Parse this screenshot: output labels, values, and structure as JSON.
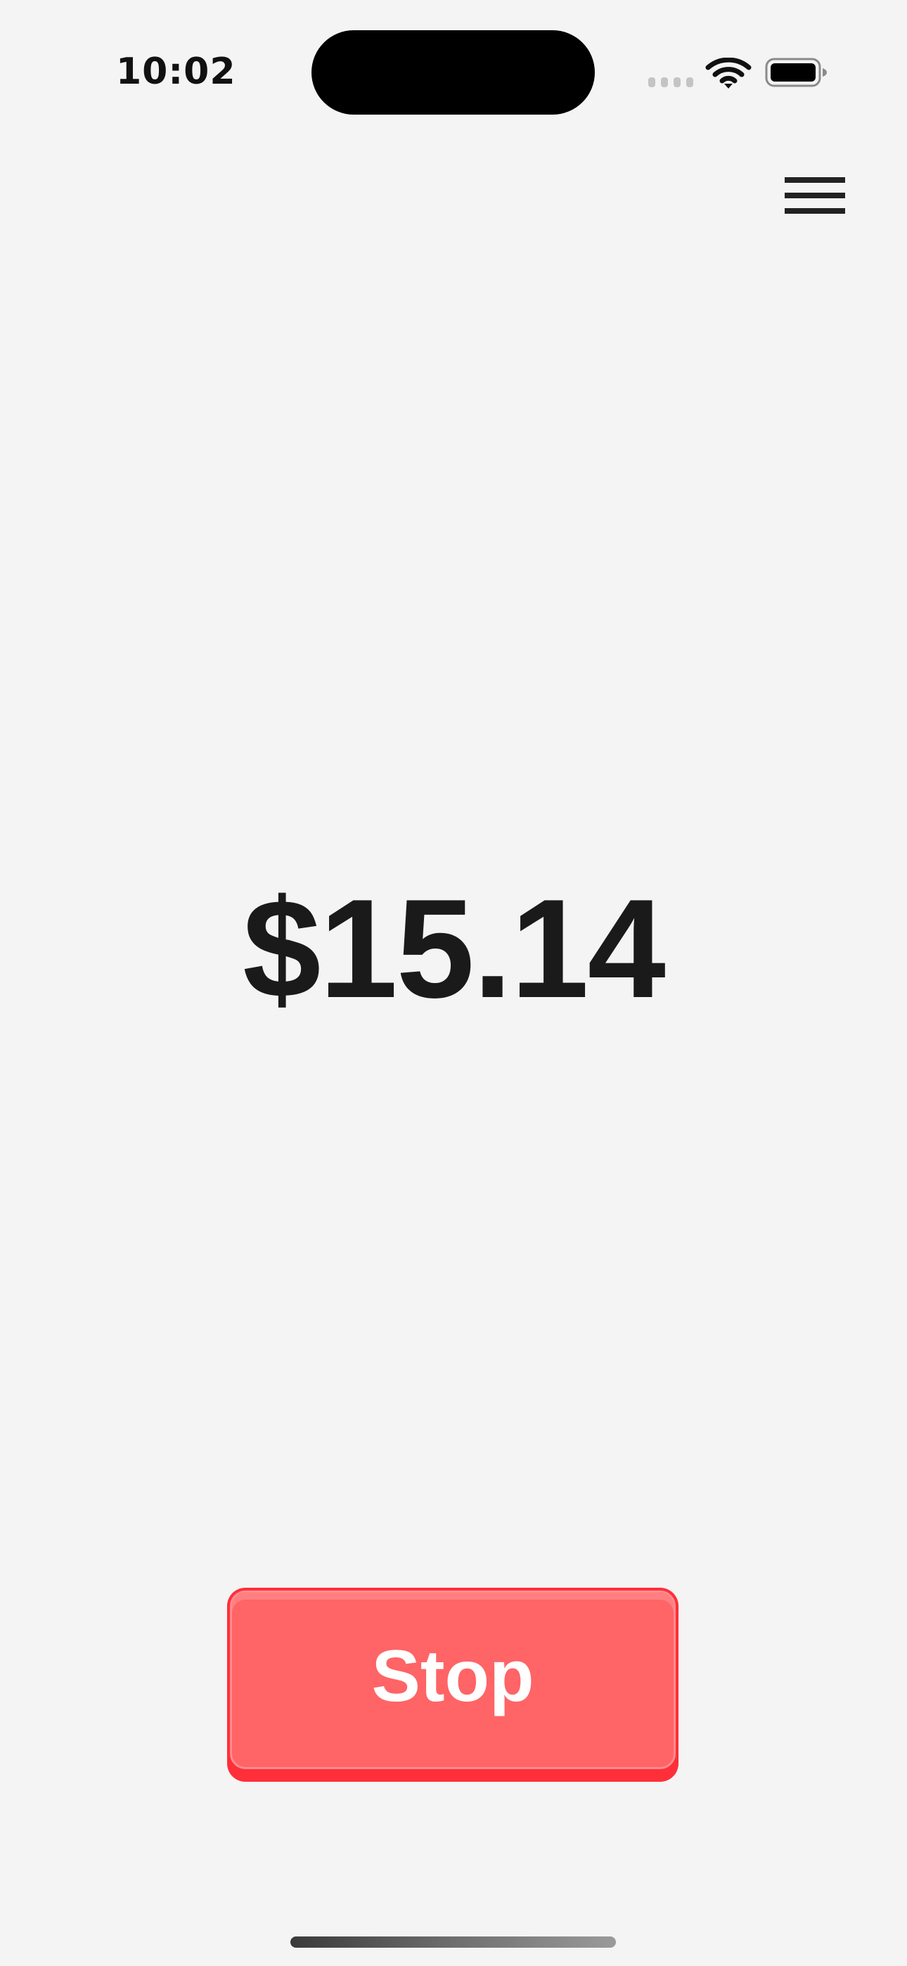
{
  "status_bar": {
    "time": "10:02",
    "wifi_icon": "wifi-icon",
    "battery_icon": "battery-full-icon",
    "signal_icon": "cellular-signal-icon"
  },
  "header": {
    "menu_icon": "hamburger-menu-icon"
  },
  "main": {
    "amount": "$15.14"
  },
  "actions": {
    "stop_label": "Stop"
  },
  "colors": {
    "background": "#f4f4f4",
    "text": "#1a1a1a",
    "stop_button": "#ff6466",
    "stop_button_edge": "#ff2f3a"
  }
}
